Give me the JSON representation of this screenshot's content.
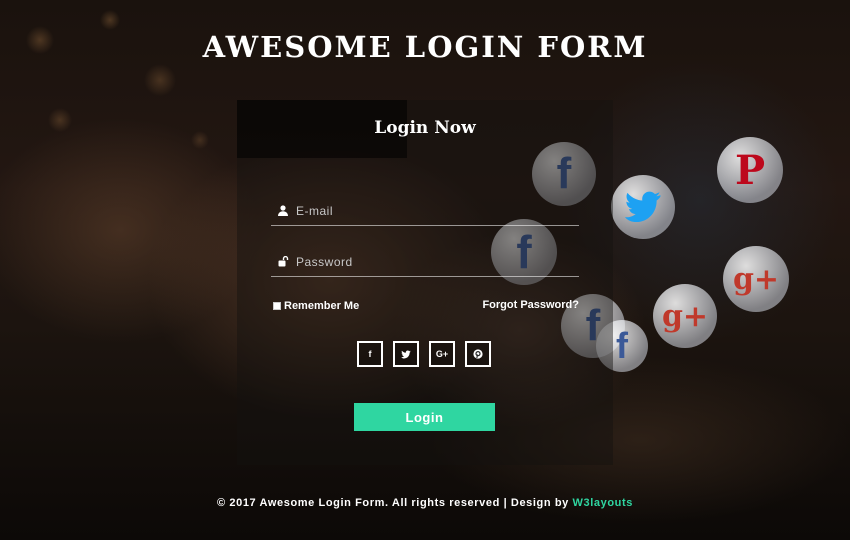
{
  "page": {
    "title": "AWESOME LOGIN FORM"
  },
  "form": {
    "heading": "Login Now",
    "email": {
      "placeholder": "E-mail",
      "value": ""
    },
    "password": {
      "placeholder": "Password",
      "value": ""
    },
    "remember_label": "Remember Me",
    "forgot_label": "Forgot Password?",
    "social_buttons": [
      {
        "icon": "facebook-icon",
        "glyph": "f"
      },
      {
        "icon": "twitter-icon",
        "glyph": "t"
      },
      {
        "icon": "google-plus-icon",
        "glyph": "G+"
      },
      {
        "icon": "pinterest-icon",
        "glyph": "P"
      }
    ],
    "login_label": "Login"
  },
  "footer": {
    "text": "© 2017 Awesome Login Form. All rights reserved | Design by ",
    "brand": "W3layouts"
  },
  "colors": {
    "accent": "#2fd6a1",
    "facebook": "#3b5998",
    "twitter": "#1da1f2",
    "google": "#c0392b",
    "pinterest": "#bd081c"
  }
}
